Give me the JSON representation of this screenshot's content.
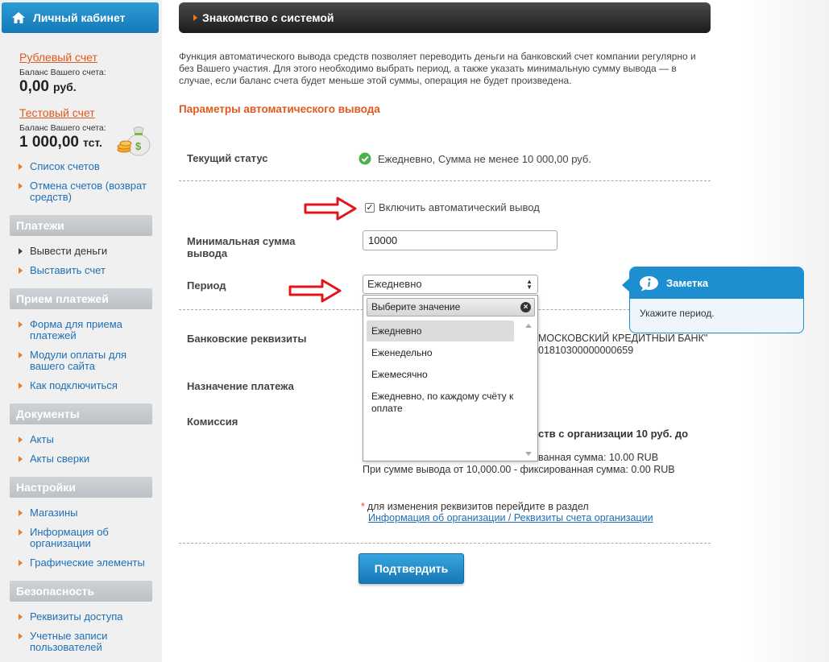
{
  "sidebar": {
    "header": "Личный кабинет",
    "accounts": [
      {
        "link": "Рублевый счет",
        "balance_label": "Баланс Вашего счета:",
        "amount": "0,00",
        "currency": "руб."
      },
      {
        "link": "Тестовый счет",
        "balance_label": "Баланс Вашего счета:",
        "amount": "1 000,00",
        "currency": "тст."
      }
    ],
    "account_links": [
      "Список счетов",
      "Отмена счетов (возврат средств)"
    ],
    "sections": [
      {
        "title": "Платежи",
        "items": [
          "Вывести деньги",
          "Выставить счет"
        ]
      },
      {
        "title": "Прием платежей",
        "items": [
          "Форма для приема платежей",
          "Модули оплаты для вашего сайта",
          "Как подключиться"
        ]
      },
      {
        "title": "Документы",
        "items": [
          "Акты",
          "Акты сверки"
        ]
      },
      {
        "title": "Настройки",
        "items": [
          "Магазины",
          "Информация об организации",
          "Графические элементы"
        ]
      },
      {
        "title": "Безопасность",
        "items": [
          "Реквизиты доступа",
          "Учетные записи пользователей"
        ]
      }
    ]
  },
  "main": {
    "topbar_title": "Знакомство с системой",
    "intro": "Функция автоматического вывода средств позволяет переводить деньги на банковский счет компании регулярно и без Вашего участия. Для этого необходимо выбрать период, а также указать минимальную сумму вывода — в случае, если баланс счета будет меньше этой суммы, операция не будет произведена.",
    "section_title": "Параметры автоматического вывода",
    "status_label": "Текущий статус",
    "status_value": "Ежедневно, Сумма не менее 10 000,00 руб.",
    "auto_withdraw_label": "Включить автоматический вывод",
    "auto_withdraw_checked": true,
    "min_amount_label": "Минимальная сумма вывода",
    "min_amount_value": "10000",
    "period_label": "Период",
    "period_value": "Ежедневно",
    "bank_label": "Банковские реквизиты",
    "bank_line1": "МОСКОВСКИЙ КРЕДИТНЫЙ БАНК\"",
    "bank_line2": "01810300000000659",
    "purpose_label": "Назначение платежа",
    "commission_label": "Комиссия",
    "commission_line1": "ств с организации 10 руб. до",
    "commission_line2": "ванная сумма: 10.00 RUB",
    "commission_line3": "При сумме вывода от 10,000.00 - фиксированная сумма: 0.00 RUB",
    "note_star": "*",
    "note_text": "для изменения реквизитов перейдите в раздел",
    "note_link": "Информация об организации / Реквизиты счета организации",
    "confirm_button": "Подтвердить"
  },
  "dropdown": {
    "header": "Выберите значение",
    "clear_glyph": "×",
    "options": [
      "Ежедневно",
      "Еженедельно",
      "Ежемесячно",
      "Ежедневно, по каждому счёту к оплате"
    ],
    "selected": "Ежедневно"
  },
  "tooltip": {
    "title": "Заметка",
    "text": "Укажите период."
  },
  "colors": {
    "accent_blue": "#1d8fd0",
    "accent_orange": "#e0581e",
    "link_blue": "#1e6fb6",
    "arrow_red": "#e3151b",
    "success_green": "#4cb24a"
  }
}
